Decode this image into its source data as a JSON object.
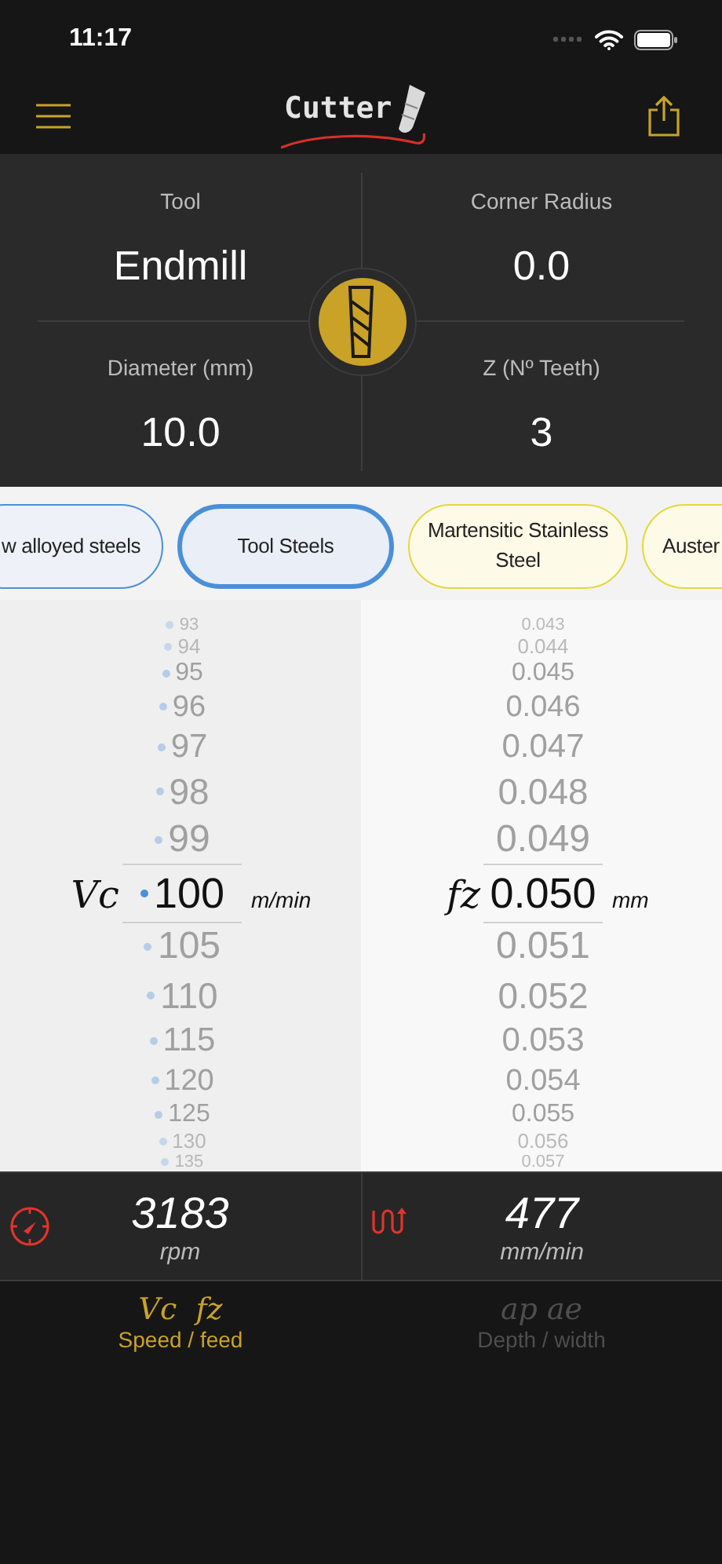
{
  "status_bar": {
    "time": "11:17"
  },
  "nav": {
    "title": "Cutter"
  },
  "tool_grid": [
    {
      "label": "Tool",
      "value": "Endmill"
    },
    {
      "label": "Corner Radius",
      "value": "0.0"
    },
    {
      "label": "Diameter (mm)",
      "value": "10.0"
    },
    {
      "label": "Z (Nº Teeth)",
      "value": "3"
    }
  ],
  "materials": [
    {
      "label": "w alloyed steels",
      "color": "#4a90d9",
      "selected": false
    },
    {
      "label": "Tool  Steels",
      "color": "#4a90d9",
      "selected": true
    },
    {
      "label": "Martensitic Stainless Steel",
      "color": "#e3d83c",
      "selected": false
    },
    {
      "label": "Auster",
      "color": "#e3d83c",
      "selected": false
    }
  ],
  "pickers": [
    {
      "symbol": "Vc",
      "unit": "m/min",
      "items": [
        {
          "value": "93",
          "selected": false
        },
        {
          "value": "94",
          "selected": false
        },
        {
          "value": "95",
          "selected": false
        },
        {
          "value": "96",
          "selected": false
        },
        {
          "value": "97",
          "selected": false
        },
        {
          "value": "98",
          "selected": false
        },
        {
          "value": "99",
          "selected": false
        },
        {
          "value": "100",
          "selected": true
        },
        {
          "value": "105",
          "selected": false
        },
        {
          "value": "110",
          "selected": false
        },
        {
          "value": "115",
          "selected": false
        },
        {
          "value": "120",
          "selected": false
        },
        {
          "value": "125",
          "selected": false
        },
        {
          "value": "130",
          "selected": false
        },
        {
          "value": "135",
          "selected": false
        }
      ]
    },
    {
      "symbol": "fz",
      "unit": "mm",
      "items": [
        {
          "value": "0.043",
          "selected": false
        },
        {
          "value": "0.044",
          "selected": false
        },
        {
          "value": "0.045",
          "selected": false
        },
        {
          "value": "0.046",
          "selected": false
        },
        {
          "value": "0.047",
          "selected": false
        },
        {
          "value": "0.048",
          "selected": false
        },
        {
          "value": "0.049",
          "selected": false
        },
        {
          "value": "0.050",
          "selected": true
        },
        {
          "value": "0.051",
          "selected": false
        },
        {
          "value": "0.052",
          "selected": false
        },
        {
          "value": "0.053",
          "selected": false
        },
        {
          "value": "0.054",
          "selected": false
        },
        {
          "value": "0.055",
          "selected": false
        },
        {
          "value": "0.056",
          "selected": false
        },
        {
          "value": "0.057",
          "selected": false
        }
      ]
    }
  ],
  "results": [
    {
      "kind": "speed",
      "value": "3183",
      "unit": "rpm"
    },
    {
      "kind": "feed",
      "value": "477",
      "unit": "mm/min"
    }
  ],
  "tabs": [
    {
      "symbol": "Vc  fz",
      "label": "Speed / feed",
      "selected": true
    },
    {
      "symbol": "ap ae",
      "label": "Depth / width",
      "selected": false
    }
  ]
}
